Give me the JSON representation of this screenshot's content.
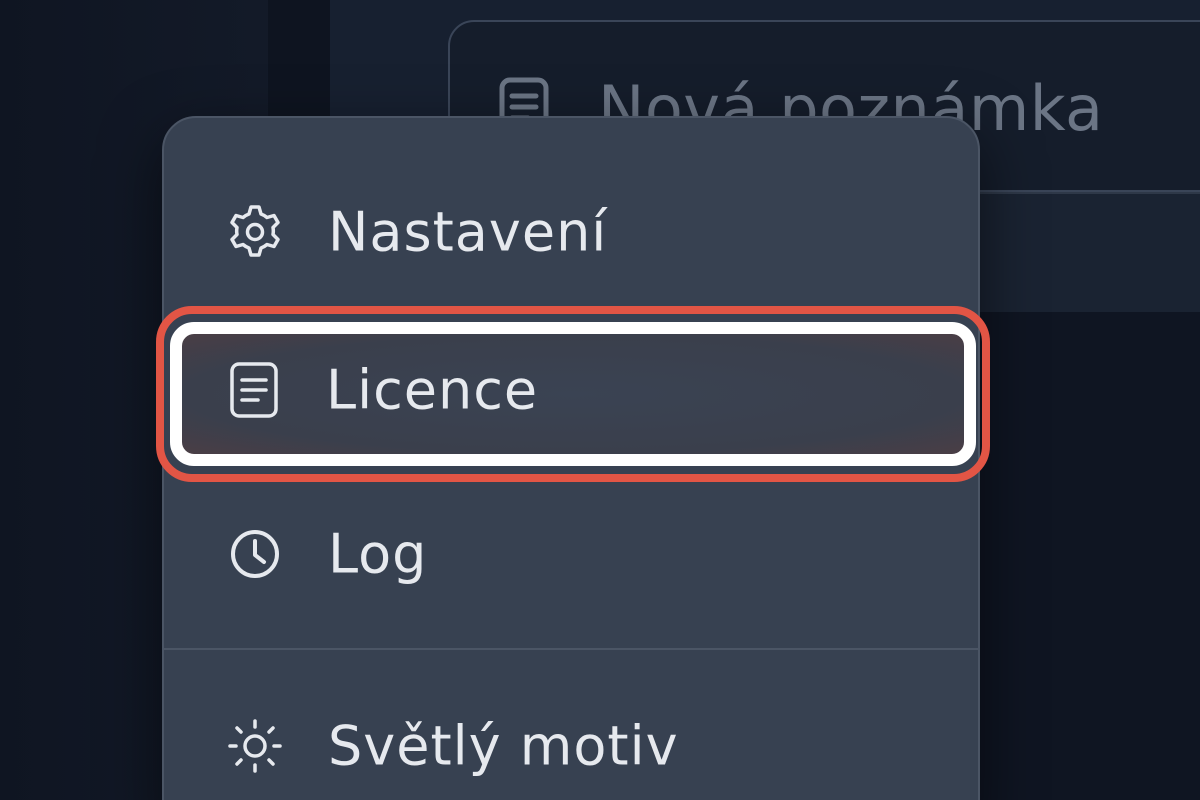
{
  "note_input": {
    "placeholder": "Nová poznámka",
    "icon": "document-icon"
  },
  "menu": {
    "items": [
      {
        "label": "Nastavení",
        "icon": "gear-icon"
      },
      {
        "label": "Licence",
        "icon": "document-icon",
        "highlighted": true
      },
      {
        "label": "Log",
        "icon": "clock-icon"
      },
      {
        "label": "Světlý motiv",
        "icon": "sun-icon"
      }
    ]
  },
  "colors": {
    "background": "#111827",
    "menu_background": "#374151",
    "highlight_outer": "#e25545",
    "highlight_inner": "#ffffff",
    "text": "#e6e9ee",
    "placeholder_text": "#6b7585"
  }
}
